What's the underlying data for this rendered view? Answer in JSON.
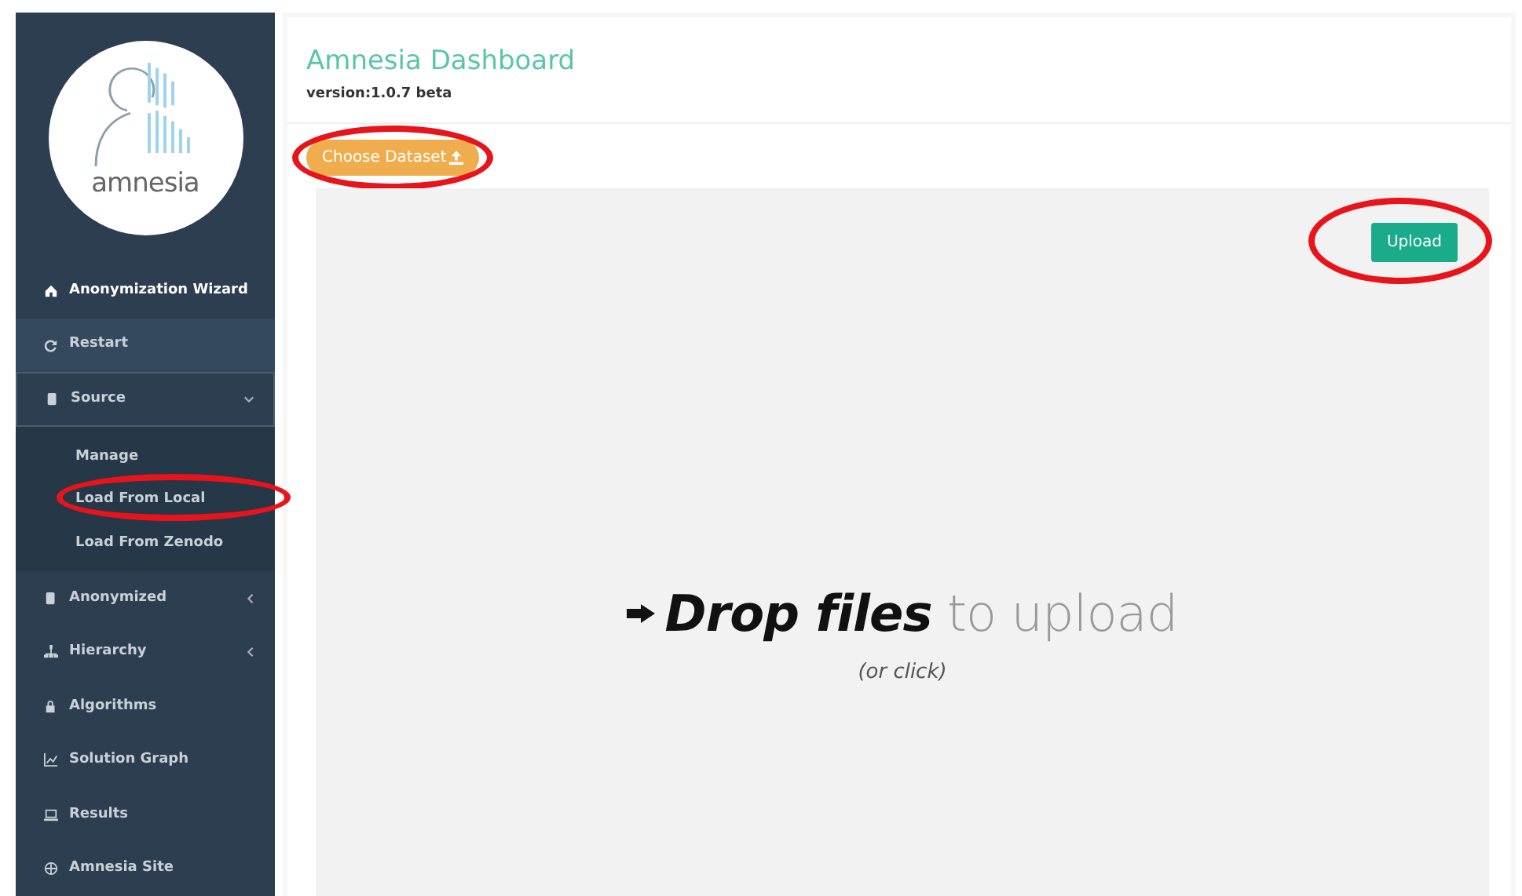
{
  "sidebar": {
    "logo_text": "amnesia",
    "items": [
      {
        "kind": "header",
        "label": "Anonymization Wizard"
      },
      {
        "kind": "link",
        "label": "Restart",
        "selected": true
      },
      {
        "kind": "group",
        "label": "Source",
        "expanded": true,
        "children": [
          {
            "label": "Manage",
            "circled": false
          },
          {
            "label": "Load From Local",
            "circled": true
          },
          {
            "label": "Load From Zenodo",
            "circled": false
          }
        ]
      },
      {
        "kind": "group",
        "label": "Anonymized",
        "expanded": false
      },
      {
        "kind": "group",
        "label": "Hierarchy",
        "expanded": false
      },
      {
        "kind": "link",
        "label": "Algorithms",
        "selected": false
      },
      {
        "kind": "link",
        "label": "Solution Graph",
        "selected": false
      },
      {
        "kind": "link",
        "label": "Results",
        "selected": false
      },
      {
        "kind": "link",
        "label": "Amnesia Site",
        "selected": false
      }
    ]
  },
  "header": {
    "title": "Amnesia Dashboard",
    "version": "version:1.0.7 beta"
  },
  "choose_button": {
    "label": "Choose Dataset",
    "circled": true
  },
  "upload_button": {
    "label": "Upload",
    "circled": true
  },
  "dropzone": {
    "message": "**Drop files** to upload",
    "hint": "(or click)"
  }
}
